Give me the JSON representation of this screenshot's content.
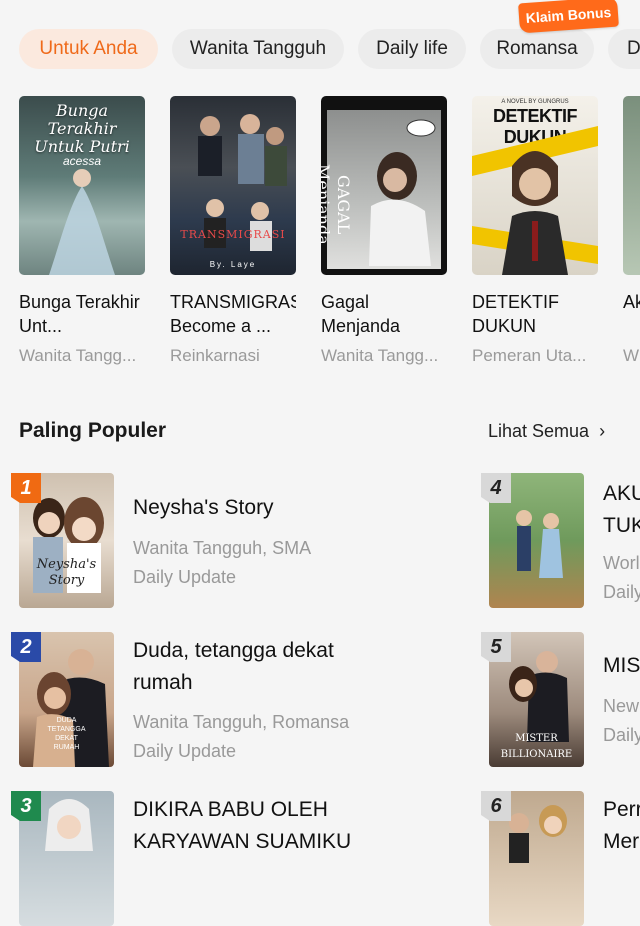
{
  "tabs": [
    {
      "label": "Untuk Anda",
      "active": true
    },
    {
      "label": "Wanita Tangguh",
      "active": false
    },
    {
      "label": "Daily life",
      "active": false
    },
    {
      "label": "Romansa",
      "active": false
    },
    {
      "label": "D",
      "active": false
    }
  ],
  "bonus_label": "Klaim Bonus",
  "books": [
    {
      "title": "Bunga Terakhir Unt...",
      "tag": "Wanita Tangg...",
      "cover_text": "Bunga Terakhir Untuk Putri",
      "cover_author": "acessa"
    },
    {
      "title": "TRANSMIGRASI: Become a ...",
      "tag": "Reinkarnasi",
      "cover_text": "TRANSMIGRASI",
      "cover_author": "By. Laye"
    },
    {
      "title": "Gagal Menjanda",
      "tag": "Wanita Tangg...",
      "cover_text": "GAGAL Menjanda",
      "cover_author": ""
    },
    {
      "title": "DETEKTIF DUKUN",
      "tag": "Pemeran Uta...",
      "cover_text": "DETEKTIF DUKUN",
      "cover_author": "A NOVEL BY GUNGRUS"
    },
    {
      "title": "Ak Ba",
      "tag": "W",
      "cover_text": "",
      "cover_author": ""
    }
  ],
  "popular": {
    "title": "Paling Populer",
    "see_all": "Lihat Semua",
    "items": [
      {
        "rank": "1",
        "title": "Neysha's Story",
        "tags": "Wanita Tangguh, SMA",
        "status": "Daily Update",
        "cover_text": "Neysha's Story",
        "badge_color": "#f06a12"
      },
      {
        "rank": "2",
        "title": "Duda, tetangga dekat rumah",
        "tags": "Wanita Tangguh, Romansa",
        "status": "Daily Update",
        "cover_text": "DUDA TETANGGA DEKAT RUMAH",
        "badge_color": "#2a4aa8"
      },
      {
        "rank": "3",
        "title": "DIKIRA BABU OLEH KARYAWAN SUAMIKU",
        "tags": "",
        "status": "",
        "cover_text": "",
        "badge_color": "#1f8a4e"
      },
      {
        "rank": "4",
        "title": "AKU TUK",
        "tags": "Worl",
        "status": "Daily",
        "cover_text": "",
        "badge_color": "#d8d8d8"
      },
      {
        "rank": "5",
        "title": "MIS",
        "tags": "New",
        "status": "Daily",
        "cover_text": "MISTER BILLIONAIRE",
        "badge_color": "#d8d8d8"
      },
      {
        "rank": "6",
        "title": "Perr Mer",
        "tags": "",
        "status": "",
        "cover_text": "",
        "badge_color": "#d8d8d8"
      }
    ]
  },
  "colors": {
    "accent": "#ef6a1a",
    "active_tab_bg": "#fbe9de",
    "tab_bg": "#ececec",
    "muted_text": "#9a9a9a"
  }
}
